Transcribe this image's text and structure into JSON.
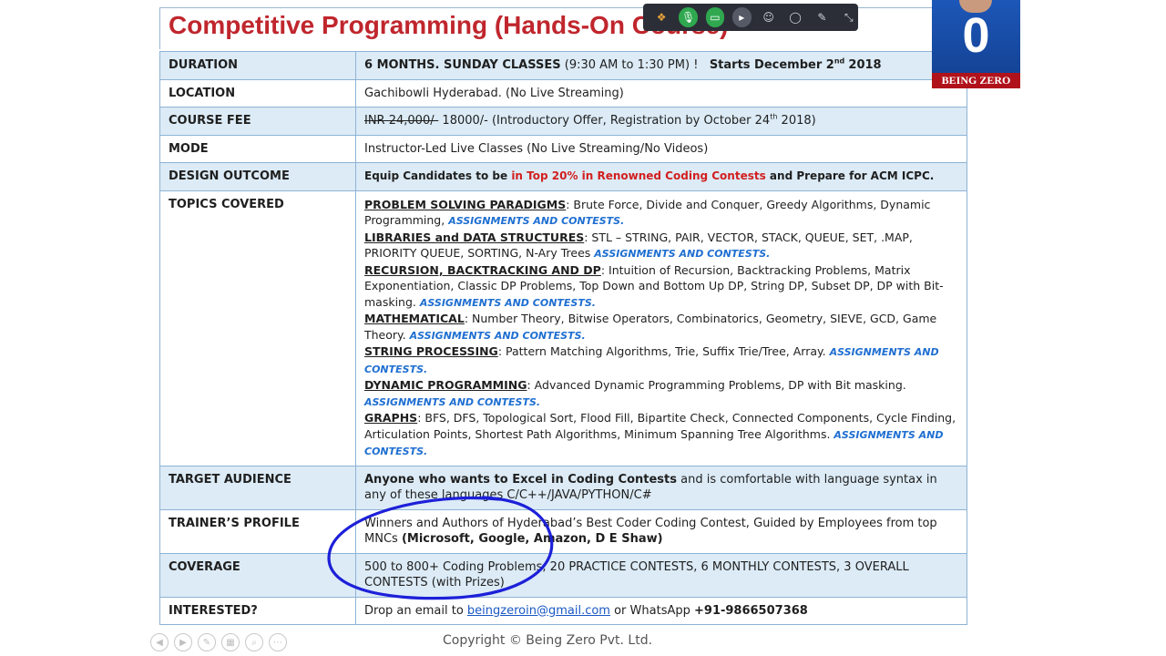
{
  "title": "Competitive Programming (Hands-On Course)",
  "rows": {
    "duration": {
      "label": "DURATION",
      "main": "6 MONTHS.  SUNDAY CLASSES",
      "time": "(9:30 AM to 1:30 PM) !",
      "starts": "Starts December 2",
      "starts_sup": "nd",
      "starts_year": "2018"
    },
    "location": {
      "label": "LOCATION",
      "value": "Gachibowli Hyderabad. (No Live Streaming)"
    },
    "fee": {
      "label": "COURSE FEE",
      "old": "INR 24,000/-",
      "new": " 18000/- (Introductory Offer, Registration by October 24",
      "sup": "th",
      "tail": " 2018)"
    },
    "mode": {
      "label": "MODE",
      "value": "Instructor-Led Live Classes (No Live Streaming/No Videos)"
    },
    "design": {
      "label": "DESIGN OUTCOME",
      "pre": "Equip Candidates to be ",
      "red": "in Top 20% in Renowned Coding Contests",
      "post": " and Prepare for ACM ICPC."
    },
    "topics": {
      "label": "TOPICS COVERED",
      "assign": "ASSIGNMENTS AND CONTESTS.",
      "items": [
        {
          "head": "PROBLEM SOLVING PARADIGMS",
          "text": ": Brute Force, Divide and Conquer, Greedy Algorithms, Dynamic Programming,  "
        },
        {
          "head": "LIBRARIES and DATA STRUCTURES",
          "text": ":  STL – STRING, PAIR, VECTOR, STACK, QUEUE, SET, .MAP, PRIORITY QUEUE, SORTING, N-Ary Trees "
        },
        {
          "head": "RECURSION, BACKTRACKING AND DP",
          "text": ": Intuition of Recursion, Backtracking Problems, Matrix Exponentiation, Classic DP Problems, Top Down and Bottom Up DP, String DP, Subset DP, DP with Bit-masking. "
        },
        {
          "head": "MATHEMATICAL",
          "text": ":  Number Theory, Bitwise Operators, Combinatorics, Geometry, SIEVE, GCD, Game Theory. "
        },
        {
          "head": "STRING PROCESSING",
          "text": ":  Pattern Matching Algorithms, Trie, Suffix Trie/Tree, Array.  "
        },
        {
          "head": "DYNAMIC PROGRAMMING",
          "text": ":  Advanced Dynamic Programming Problems, DP with Bit masking.  "
        },
        {
          "head": "GRAPHS",
          "text": ":  BFS, DFS, Topological Sort, Flood Fill, Bipartite Check, Connected Components, Cycle Finding, Articulation Points, Shortest Path Algorithms, Minimum Spanning Tree Algorithms.  "
        }
      ]
    },
    "audience": {
      "label": "TARGET AUDIENCE",
      "bold": "Anyone who wants to Excel in Coding Contests",
      "rest": " and is comfortable with language syntax in any of these languages C/C++/JAVA/PYTHON/C#"
    },
    "trainer": {
      "label": "TRAINER’S PROFILE",
      "text": "Winners and Authors of Hyderabad’s Best Coder Coding Contest, Guided by Employees from top MNCs ",
      "bold": "(Microsoft, Google, Amazon, D E Shaw)"
    },
    "coverage": {
      "label": "COVERAGE",
      "value": "500 to 800+ Coding Problems, 20 PRACTICE CONTESTS, 6 MONTHLY CONTESTS, 3 OVERALL CONTESTS (with Prizes)"
    },
    "interested": {
      "label": "INTERESTED?",
      "pre": "Drop an email to ",
      "email": "beingzeroin@gmail.com",
      "mid": " or WhatsApp ",
      "phone": "+91-9866507368"
    }
  },
  "footer": "Copyright © Being Zero Pvt. Ltd.",
  "logo": {
    "number": "0",
    "text": "BEING ZERO"
  },
  "toolbar": {
    "icons": [
      "sticker-icon",
      "microphone-icon",
      "screen-share-icon",
      "camera-icon",
      "participants-icon",
      "chat-icon",
      "pen-icon",
      "collapse-icon"
    ]
  },
  "colors": {
    "title": "#c0262d",
    "highlight": "#dcebf6",
    "border": "#8db3d5",
    "assign": "#1f6fd1",
    "annotation": "#1d20d8"
  }
}
